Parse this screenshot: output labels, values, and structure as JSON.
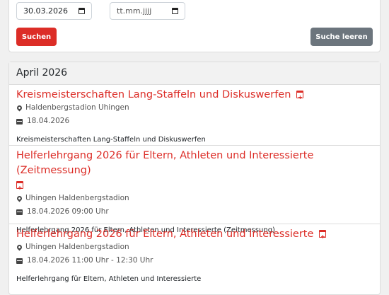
{
  "filter": {
    "date_from": "30.03.2026",
    "date_to_placeholder": "tt.mm.jjjj",
    "search_label": "Suchen",
    "clear_label": "Suche leeren"
  },
  "month": "April 2026",
  "events": [
    {
      "title": "Kreismeisterschaften Lang-Staffeln und Diskuswerfen",
      "location": "Haldenbergstadion Uhingen",
      "date": "18.04.2026",
      "description": "Kreismeisterschaften Lang-Staffeln und Diskuswerfen"
    },
    {
      "title": "Helferlehrgang 2026 für Eltern, Athleten und Interessierte (Zeitmessung)",
      "location": "Uhingen Haldenbergstadion",
      "date": "18.04.2026 09:00 Uhr",
      "description": "Helferlehrgang 2026 für Eltern, Athleten und Interessierte (Zeitmessung)"
    },
    {
      "title": "Helferlehrgang 2026 für Eltern, Athleten und Interessierte",
      "location": "Uhingen Haldenbergstadion",
      "date": "18.04.2026 11:00 Uhr - 12:30 Uhr",
      "description": "Helferlehrgang für Eltern, Athleten und Interessierte"
    }
  ],
  "colors": {
    "accent": "#dc2d27",
    "secondary": "#6c757d"
  }
}
